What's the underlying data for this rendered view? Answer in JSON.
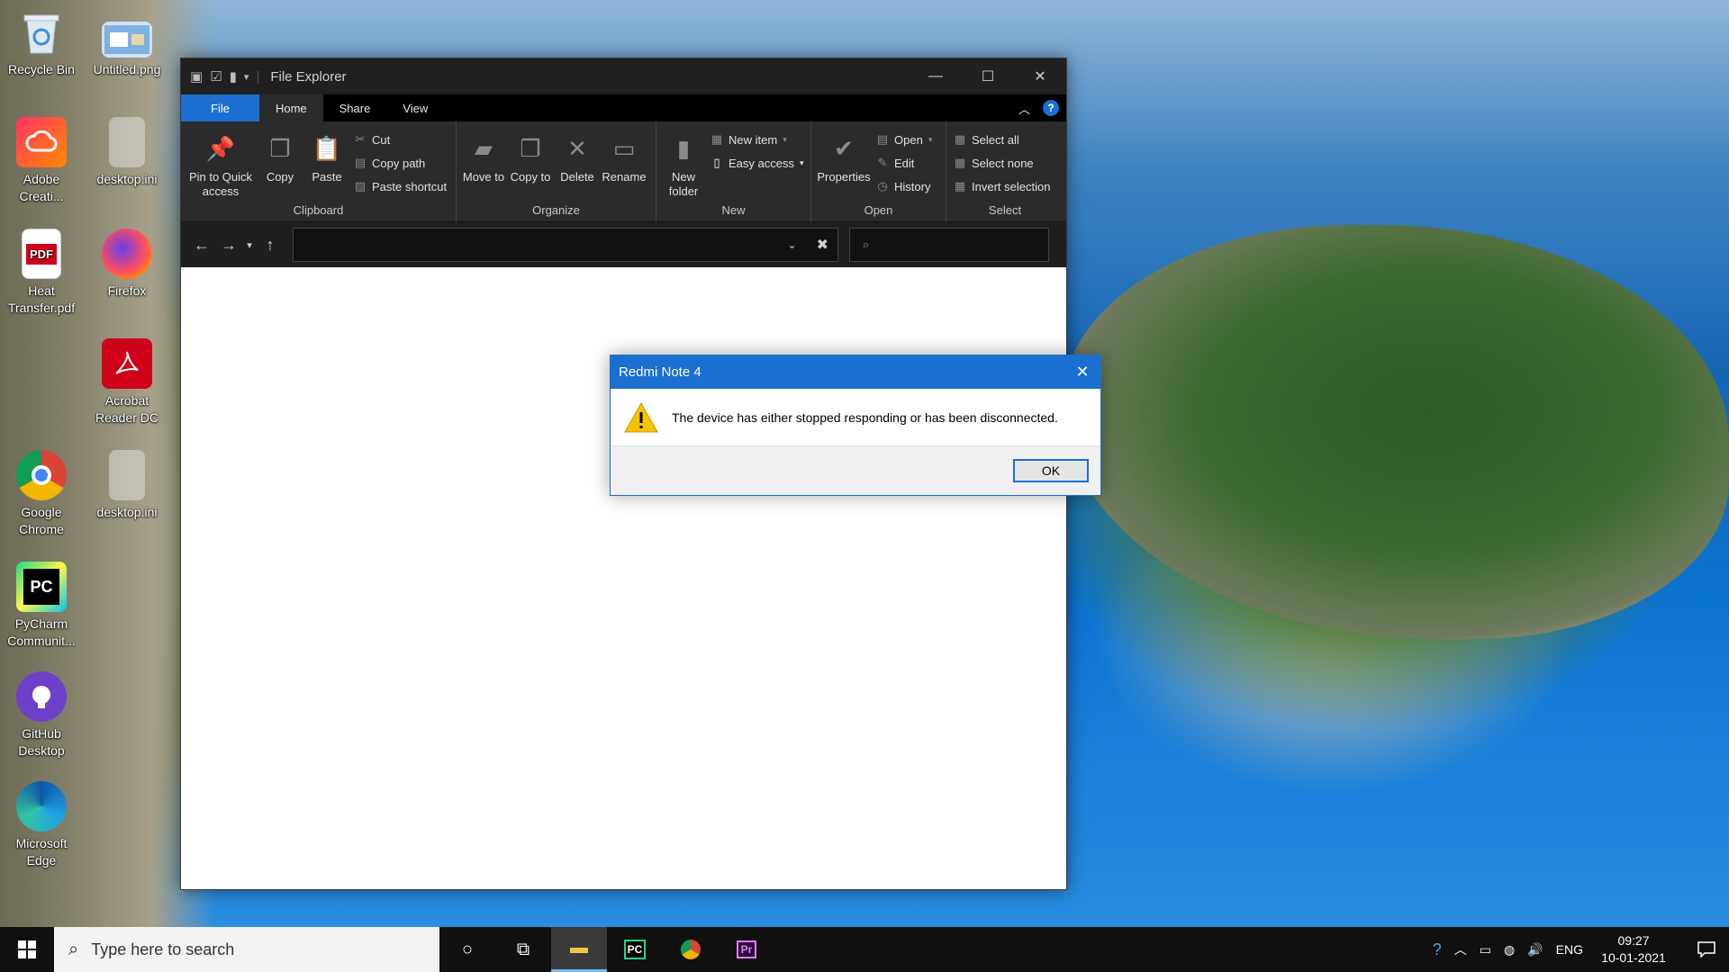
{
  "desktop": {
    "icons": [
      {
        "label": "Recycle Bin"
      },
      {
        "label": "Untitled.png"
      },
      {
        "label": "Adobe Creati..."
      },
      {
        "label": "desktop.ini"
      },
      {
        "label": "Heat Transfer.pdf"
      },
      {
        "label": "Firefox"
      },
      {
        "label": "Acrobat Reader DC"
      },
      {
        "label": "Google Chrome"
      },
      {
        "label": "desktop.ini"
      },
      {
        "label": "PyCharm Communit..."
      },
      {
        "label": "GitHub Desktop"
      },
      {
        "label": "Microsoft Edge"
      }
    ]
  },
  "explorer": {
    "title": "File Explorer",
    "tabs": [
      "File",
      "Home",
      "Share",
      "View"
    ],
    "ribbon": {
      "clipboard": {
        "name": "Clipboard",
        "pin": "Pin to Quick access",
        "copy": "Copy",
        "paste": "Paste",
        "cut": "Cut",
        "copy_path": "Copy path",
        "paste_shortcut": "Paste shortcut"
      },
      "organize": {
        "name": "Organize",
        "move_to": "Move to",
        "copy_to": "Copy to",
        "delete": "Delete",
        "rename": "Rename"
      },
      "new": {
        "name": "New",
        "new_folder": "New folder",
        "new_item": "New item",
        "easy_access": "Easy access"
      },
      "open": {
        "name": "Open",
        "properties": "Properties",
        "open": "Open",
        "edit": "Edit",
        "history": "History"
      },
      "select": {
        "name": "Select",
        "select_all": "Select all",
        "select_none": "Select none",
        "invert_selection": "Invert selection"
      }
    },
    "address_value": "",
    "search_value": ""
  },
  "dialog": {
    "title": "Redmi Note 4",
    "message": "The device has either stopped responding or has been disconnected.",
    "ok_label": "OK"
  },
  "taskbar": {
    "search_placeholder": "Type here to search",
    "language": "ENG",
    "time": "09:27",
    "date": "10-01-2021"
  },
  "colors": {
    "accent": "#1a6fd0",
    "ribbon_bg": "#2b2b2b",
    "warning": "#f5c400"
  }
}
